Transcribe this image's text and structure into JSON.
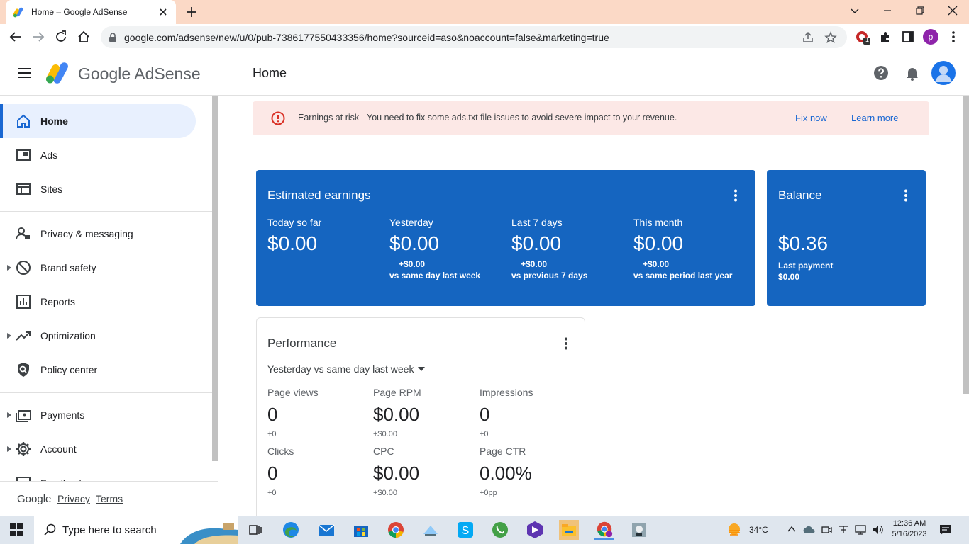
{
  "browser": {
    "tab_title": "Home – Google AdSense",
    "url": "google.com/adsense/new/u/0/pub-7386177550433356/home?sourceid=aso&noaccount=false&marketing=true",
    "profile_initial": "p",
    "extension_badge": "1"
  },
  "header": {
    "brand": "Google AdSense",
    "page_title": "Home"
  },
  "sidebar": {
    "items": [
      {
        "label": "Home",
        "icon": "home-icon",
        "active": true
      },
      {
        "label": "Ads",
        "icon": "ads-icon"
      },
      {
        "label": "Sites",
        "icon": "sites-icon"
      },
      {
        "label": "Privacy & messaging",
        "icon": "privacy-icon"
      },
      {
        "label": "Brand safety",
        "icon": "block-icon"
      },
      {
        "label": "Reports",
        "icon": "reports-icon"
      },
      {
        "label": "Optimization",
        "icon": "trending-icon"
      },
      {
        "label": "Policy center",
        "icon": "policy-shield-icon"
      },
      {
        "label": "Payments",
        "icon": "payments-icon"
      },
      {
        "label": "Account",
        "icon": "gear-icon"
      },
      {
        "label": "Feedback",
        "icon": "feedback-icon"
      }
    ],
    "footer": {
      "google": "Google",
      "privacy": "Privacy",
      "terms": "Terms"
    }
  },
  "alert": {
    "text": "Earnings at risk - You need to fix some ads.txt file issues to avoid severe impact to your revenue.",
    "fix_label": "Fix now",
    "learn_label": "Learn more",
    "color": "#d93025"
  },
  "earnings": {
    "title": "Estimated earnings",
    "columns": [
      {
        "label": "Today so far",
        "value": "$0.00",
        "delta": "",
        "compare": ""
      },
      {
        "label": "Yesterday",
        "value": "$0.00",
        "delta": "+$0.00",
        "compare": "vs same day last week"
      },
      {
        "label": "Last 7 days",
        "value": "$0.00",
        "delta": "+$0.00",
        "compare": "vs previous 7 days"
      },
      {
        "label": "This month",
        "value": "$0.00",
        "delta": "+$0.00",
        "compare": "vs same period last year"
      }
    ],
    "color": "#1565c0"
  },
  "balance": {
    "title": "Balance",
    "value": "$0.36",
    "last_payment_label": "Last payment",
    "last_payment_value": "$0.00"
  },
  "performance": {
    "title": "Performance",
    "range": "Yesterday vs same day last week",
    "metrics": [
      {
        "label": "Page views",
        "value": "0",
        "delta": "+0"
      },
      {
        "label": "Page RPM",
        "value": "$0.00",
        "delta": "+$0.00"
      },
      {
        "label": "Impressions",
        "value": "0",
        "delta": "+0"
      },
      {
        "label": "Clicks",
        "value": "0",
        "delta": "+0"
      },
      {
        "label": "CPC",
        "value": "$0.00",
        "delta": "+$0.00"
      },
      {
        "label": "Page CTR",
        "value": "0.00%",
        "delta": "+0pp"
      }
    ]
  },
  "taskbar": {
    "search_placeholder": "Type here to search",
    "weather": "34°C",
    "time": "12:36 AM",
    "date": "5/16/2023"
  }
}
